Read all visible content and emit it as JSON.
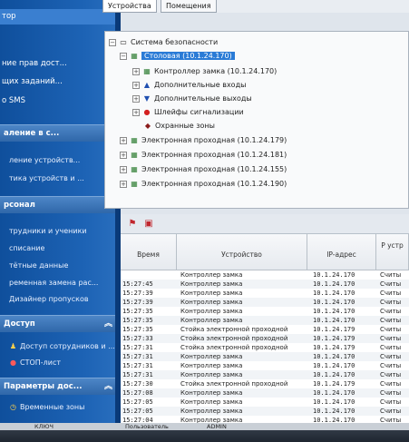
{
  "sidebar": {
    "items": [
      {
        "label": "тор"
      },
      {
        "label": "ние прав дост..."
      },
      {
        "label": "щих заданий..."
      },
      {
        "label": "о SMS"
      }
    ],
    "group1": {
      "label": "аление в с..."
    },
    "group1_items": [
      {
        "label": "ление устройств..."
      },
      {
        "label": "тика устройств и ..."
      }
    ],
    "group2": {
      "label": "рсонал"
    },
    "group2_items": [
      {
        "label": "трудники и ученики"
      },
      {
        "label": "списание"
      },
      {
        "label": "тётные данные"
      },
      {
        "label": "ременная замена рас..."
      },
      {
        "label": "Дизайнер пропусков"
      }
    ],
    "group3": {
      "label": "Доступ"
    },
    "group3_items": [
      {
        "label": "Доступ сотрудников и ..."
      },
      {
        "label": "СТОП-лист"
      }
    ],
    "group4": {
      "label": "Параметры дос..."
    },
    "group4_items": [
      {
        "label": "Временные зоны"
      }
    ]
  },
  "tabs": [
    {
      "label": "Устройства"
    },
    {
      "label": "Помещения"
    }
  ],
  "tree": {
    "root": "Система безопасности",
    "selected": "Столовая (10.1.24.170)",
    "nodes": [
      {
        "label": "Контроллер замка (10.1.24.170)"
      },
      {
        "label": "Дополнительные входы"
      },
      {
        "label": "Дополнительные выходы"
      },
      {
        "label": "Шлейфы сигнализации"
      },
      {
        "label": "Охранные зоны"
      },
      {
        "label": "Электронная проходная (10.1.24.179)"
      },
      {
        "label": "Электронная проходная (10.1.24.181)"
      },
      {
        "label": "Электронная проходная (10.1.24.155)"
      },
      {
        "label": "Электронная проходная (10.1.24.190)"
      }
    ]
  },
  "grid": {
    "headers": [
      "Время",
      "Устройство",
      "IP-адрес",
      "Р устр"
    ],
    "rows": [
      {
        "time": "",
        "device": "Контроллер замка",
        "ip": "10.1.24.170",
        "r": "Считы"
      },
      {
        "time": "15:27:45",
        "device": "Контроллер замка",
        "ip": "10.1.24.170",
        "r": "Считы"
      },
      {
        "time": "15:27:39",
        "device": "Контроллер замка",
        "ip": "10.1.24.170",
        "r": "Считы"
      },
      {
        "time": "15:27:39",
        "device": "Контроллер замка",
        "ip": "10.1.24.170",
        "r": "Считы"
      },
      {
        "time": "15:27:35",
        "device": "Контроллер замка",
        "ip": "10.1.24.170",
        "r": "Считы"
      },
      {
        "time": "15:27:35",
        "device": "Контроллер замка",
        "ip": "10.1.24.170",
        "r": "Считы"
      },
      {
        "time": "15:27:35",
        "device": "Стойка электронной проходной",
        "ip": "10.1.24.179",
        "r": "Считы"
      },
      {
        "time": "15:27:33",
        "device": "Стойка электронной проходной",
        "ip": "10.1.24.179",
        "r": "Считы"
      },
      {
        "time": "15:27:31",
        "device": "Стойка электронной проходной",
        "ip": "10.1.24.179",
        "r": "Считы"
      },
      {
        "time": "15:27:31",
        "device": "Контроллер замка",
        "ip": "10.1.24.170",
        "r": "Считы"
      },
      {
        "time": "15:27:31",
        "device": "Контроллер замка",
        "ip": "10.1.24.170",
        "r": "Считы"
      },
      {
        "time": "15:27:31",
        "device": "Контроллер замка",
        "ip": "10.1.24.170",
        "r": "Считы"
      },
      {
        "time": "15:27:30",
        "device": "Стойка электронной проходной",
        "ip": "10.1.24.179",
        "r": "Считы"
      },
      {
        "time": "15:27:08",
        "device": "Контроллер замка",
        "ip": "10.1.24.170",
        "r": "Считы"
      },
      {
        "time": "15:27:05",
        "device": "Контроллер замка",
        "ip": "10.1.24.170",
        "r": "Считы"
      },
      {
        "time": "15:27:05",
        "device": "Контроллер замка",
        "ip": "10.1.24.170",
        "r": "Считы"
      },
      {
        "time": "15:27:04",
        "device": "Контроллер замка",
        "ip": "10.1.24.170",
        "r": "Считы"
      }
    ]
  },
  "status": {
    "left": "КЛЮЧ",
    "user_label": "Пользователь",
    "user": "ADMIN"
  },
  "colors": {
    "sidebar": "#1d63b5",
    "selection": "#2a7bd6",
    "alarm_red": "#c0262d"
  },
  "icons": [
    "folder-icon",
    "device-icon",
    "input-icon",
    "output-icon",
    "alarm-loop-icon",
    "security-zone-icon"
  ]
}
